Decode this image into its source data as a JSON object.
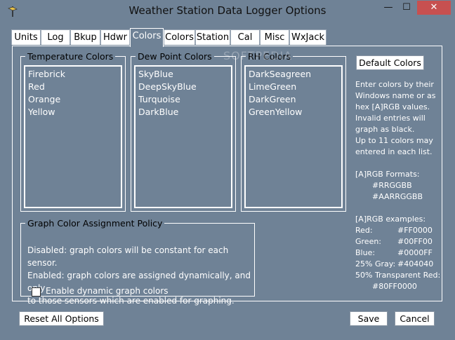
{
  "window": {
    "title": "Weather Station Data Logger Options",
    "close_glyph": "✕",
    "min_glyph": "—",
    "max_glyph": "☐"
  },
  "tabs": [
    {
      "label": "Units"
    },
    {
      "label": "Log"
    },
    {
      "label": "Bkup"
    },
    {
      "label": "Hdwr"
    },
    {
      "label": "Colors",
      "active": true
    },
    {
      "label": "Colors"
    },
    {
      "label": "Station"
    },
    {
      "label": "Cal"
    },
    {
      "label": "Misc"
    },
    {
      "label": "WxJack"
    }
  ],
  "groups": {
    "temperature": {
      "title": "Temperature Colors",
      "items": [
        "Firebrick",
        "Red",
        "Orange",
        "Yellow"
      ]
    },
    "dewpoint": {
      "title": "Dew Point Colors",
      "items": [
        "SkyBlue",
        "DeepSkyBlue",
        "Turquoise",
        "DarkBlue"
      ]
    },
    "rh": {
      "title": "RH Colors",
      "items": [
        "DarkSeagreen",
        "LimeGreen",
        "DarkGreen",
        "GreenYellow"
      ]
    }
  },
  "buttons": {
    "default_colors": "Default Colors",
    "reset_all": "Reset All Options",
    "save": "Save",
    "cancel": "Cancel"
  },
  "help": {
    "lines": [
      "Enter colors by their",
      "Windows name or as",
      "hex [A]RGB values.",
      "Invalid entries will",
      "graph as black.",
      "Up to 11 colors may",
      "entered in each list."
    ],
    "formats_title": "[A]RGB Formats:",
    "formats": [
      "#RRGGBB",
      "#AARRGGBB"
    ],
    "examples_title": "[A]RGB examples:",
    "examples": [
      {
        "name": "Red:",
        "value": "#FF0000"
      },
      {
        "name": "Green:",
        "value": "#00FF00"
      },
      {
        "name": "Blue:",
        "value": "#0000FF"
      },
      {
        "name": "25% Gray:",
        "value": "#404040"
      }
    ],
    "transparent_label": "50% Transparent Red:",
    "transparent_value": "#80FF0000"
  },
  "policy": {
    "title": "Graph Color Assignment Policy",
    "line1": "Disabled: graph colors will be constant for each sensor.",
    "line2": "Enabled: graph colors are assigned dynamically, and only",
    "line3": "to those sensors which are enabled for graphing.",
    "checkbox_label": "Enable dynamic graph colors",
    "checked": false
  },
  "watermark": "SOFTPEDIA"
}
